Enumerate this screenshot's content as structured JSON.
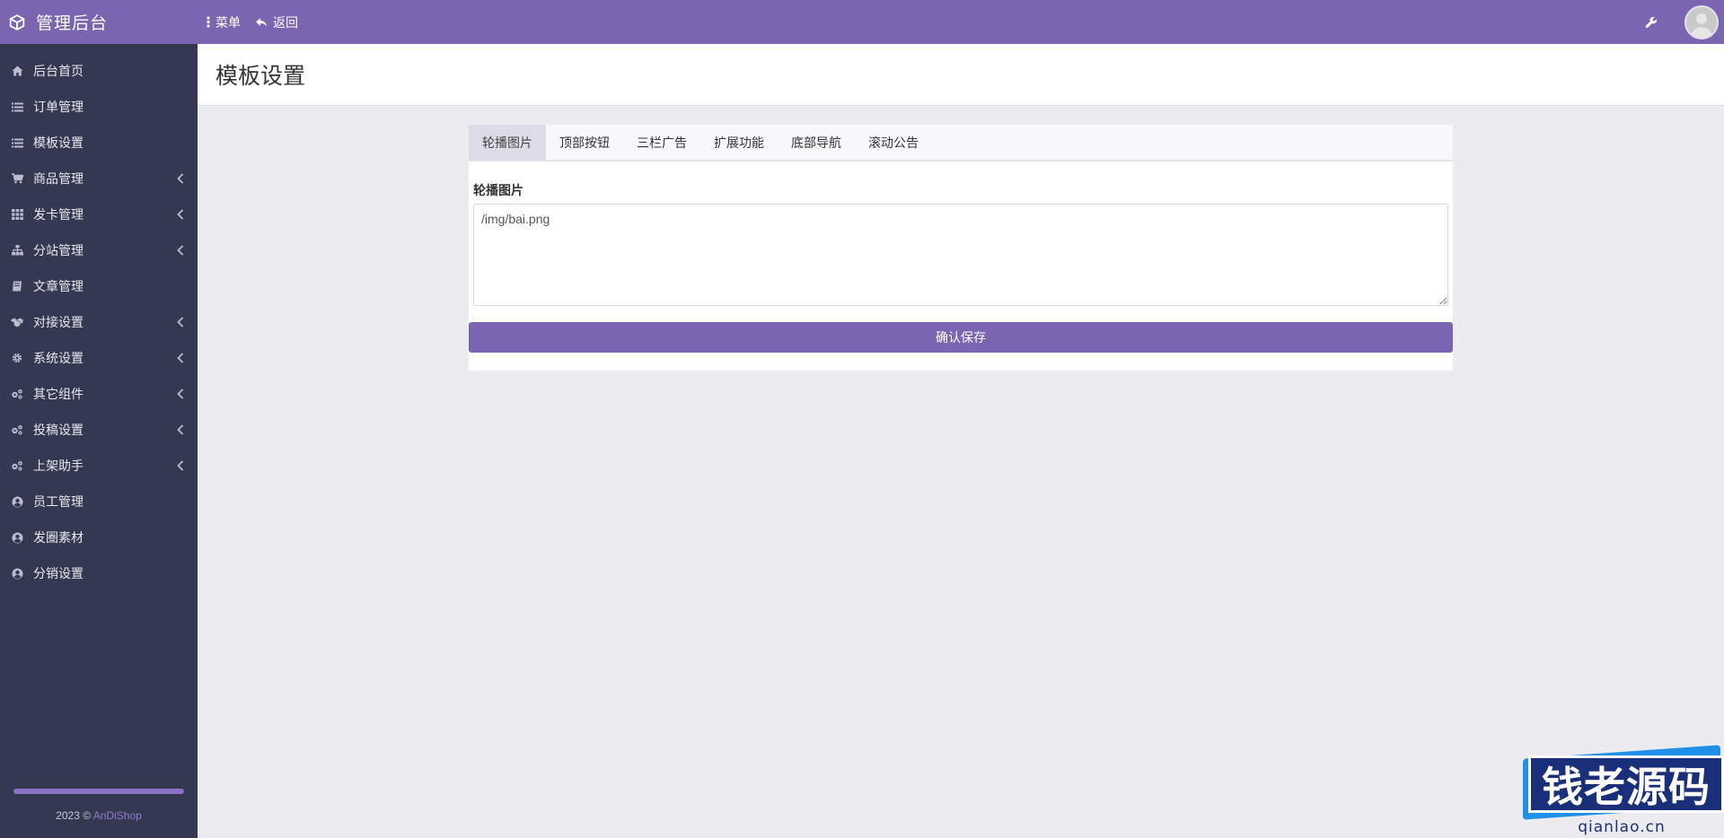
{
  "header": {
    "brand": "管理后台",
    "nav": [
      {
        "label": "菜单",
        "icon": "more-vertical-icon"
      },
      {
        "label": "返回",
        "icon": "reply-icon"
      }
    ],
    "tools_icon": "wrench-icon",
    "avatar_icon": "user-avatar-icon"
  },
  "sidebar": {
    "items": [
      {
        "label": "后台首页",
        "icon": "home-icon",
        "has_children": false
      },
      {
        "label": "订单管理",
        "icon": "list-icon",
        "has_children": false
      },
      {
        "label": "模板设置",
        "icon": "list-icon",
        "has_children": false
      },
      {
        "label": "商品管理",
        "icon": "cart-icon",
        "has_children": true
      },
      {
        "label": "发卡管理",
        "icon": "grid-icon",
        "has_children": true
      },
      {
        "label": "分站管理",
        "icon": "sitemap-icon",
        "has_children": true
      },
      {
        "label": "文章管理",
        "icon": "book-icon",
        "has_children": false
      },
      {
        "label": "对接设置",
        "icon": "cubes-icon",
        "has_children": true
      },
      {
        "label": "系统设置",
        "icon": "gear-icon",
        "has_children": true
      },
      {
        "label": "其它组件",
        "icon": "gears-icon",
        "has_children": true
      },
      {
        "label": "投稿设置",
        "icon": "gears-icon",
        "has_children": true
      },
      {
        "label": "上架助手",
        "icon": "gears-icon",
        "has_children": true
      },
      {
        "label": "员工管理",
        "icon": "user-circle-icon",
        "has_children": false
      },
      {
        "label": "发圈素材",
        "icon": "user-circle-icon",
        "has_children": false
      },
      {
        "label": "分销设置",
        "icon": "user-circle-icon",
        "has_children": false
      }
    ],
    "progress_fraction": 1.0,
    "footer_prefix": "2023 © ",
    "footer_link": "AnDiShop"
  },
  "page": {
    "title": "模板设置"
  },
  "tabs": [
    {
      "label": "轮播图片",
      "active": true
    },
    {
      "label": "顶部按钮",
      "active": false
    },
    {
      "label": "三栏广告",
      "active": false
    },
    {
      "label": "扩展功能",
      "active": false
    },
    {
      "label": "底部导航",
      "active": false
    },
    {
      "label": "滚动公告",
      "active": false
    }
  ],
  "form": {
    "label": "轮播图片",
    "value": "/img/bai.png",
    "submit_label": "确认保存"
  },
  "watermark": {
    "text": "钱老源码",
    "url": "qianlao.cn"
  },
  "colors": {
    "accent": "#7b65b0",
    "sidebar_bg": "#353851",
    "body_bg": "#ecebef"
  }
}
